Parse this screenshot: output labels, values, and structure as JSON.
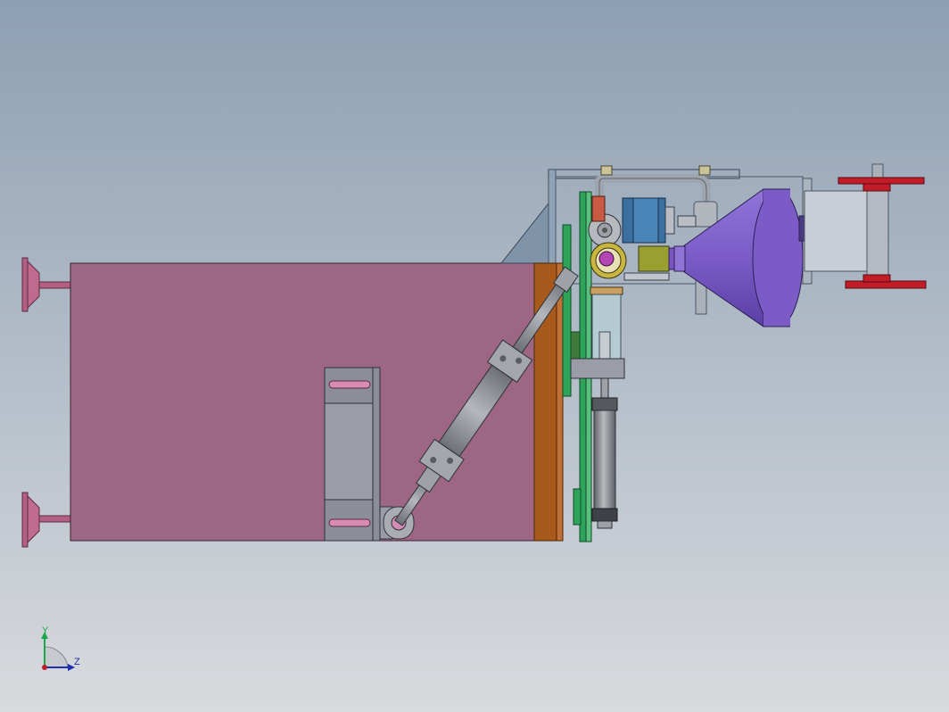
{
  "viewport": {
    "background_top": "#8d9fb3",
    "background_bottom": "#d8dadd"
  },
  "colors": {
    "body_pink": "#9d6784",
    "foot_pink": "#c06a8e",
    "orange_plate": "#a85a1c",
    "green_plate": "#2ea35a",
    "cylinder_gray": "#8e9196",
    "bracket_gray": "#8b8d99",
    "slot_pink": "#d98bb0",
    "frame_blue": "#7f94a8",
    "cone_purple": "#7b5cc7",
    "motor_blue": "#3a6fa0",
    "motor_olive": "#9aa030",
    "clamp_red": "#c21c28",
    "axis_y": "#1aa84a",
    "axis_z": "#1c2fb0",
    "axis_origin": "#c01c28"
  },
  "triad": {
    "y_label": "Y",
    "z_label": "Z"
  }
}
